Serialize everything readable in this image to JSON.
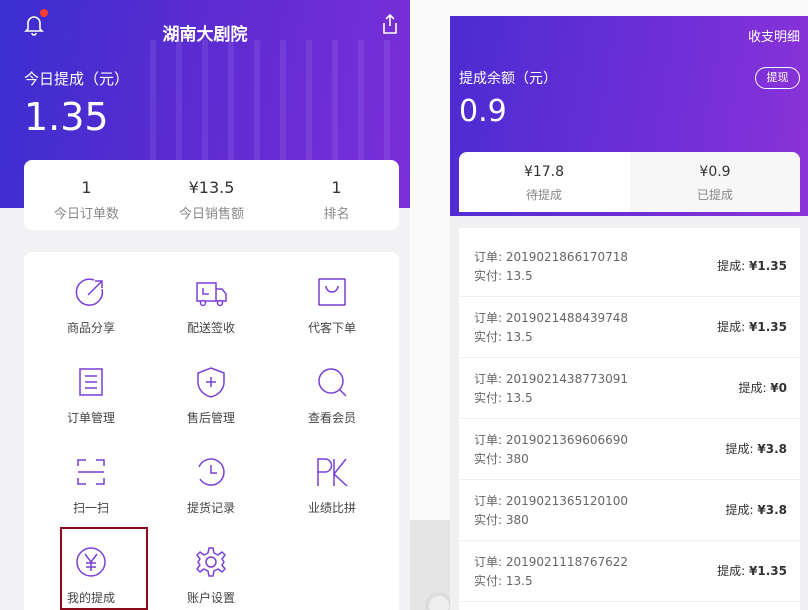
{
  "left": {
    "title": "湖南大剧院",
    "today_caption": "今日提成（元）",
    "today_amount": "1.35",
    "stats": [
      {
        "value": "1",
        "label": "今日订单数"
      },
      {
        "value": "¥13.5",
        "label": "今日销售额"
      },
      {
        "value": "1",
        "label": "排名"
      }
    ],
    "menu": [
      {
        "label": "商品分享",
        "icon": "share-arrow-icon"
      },
      {
        "label": "配送签收",
        "icon": "truck-icon"
      },
      {
        "label": "代客下单",
        "icon": "shopping-bag-icon"
      },
      {
        "label": "订单管理",
        "icon": "order-list-icon"
      },
      {
        "label": "售后管理",
        "icon": "shield-plus-icon"
      },
      {
        "label": "查看会员",
        "icon": "search-icon"
      },
      {
        "label": "扫一扫",
        "icon": "scan-icon"
      },
      {
        "label": "提货记录",
        "icon": "history-clock-icon"
      },
      {
        "label": "业绩比拼",
        "icon": "pk-icon"
      },
      {
        "label": "我的提成",
        "icon": "yuan-icon"
      },
      {
        "label": "账户设置",
        "icon": "gear-icon"
      }
    ],
    "accent_color": "#7a3fd6"
  },
  "right": {
    "detail_link": "收支明细",
    "balance_caption": "提成余额（元）",
    "withdraw_button": "提现",
    "balance_amount": "0.9",
    "tabs": [
      {
        "value": "¥17.8",
        "label": "待提成"
      },
      {
        "value": "¥0.9",
        "label": "已提成"
      }
    ],
    "records": [
      {
        "order": "订单: 2019021866170718",
        "paid": "实付: 13.5",
        "commission_label": "提成: ",
        "commission_value": "¥1.35"
      },
      {
        "order": "订单: 2019021488439748",
        "paid": "实付: 13.5",
        "commission_label": "提成: ",
        "commission_value": "¥1.35"
      },
      {
        "order": "订单: 2019021438773091",
        "paid": "实付: 13.5",
        "commission_label": "提成: ",
        "commission_value": "¥0"
      },
      {
        "order": "订单: 2019021369606690",
        "paid": "实付: 380",
        "commission_label": "提成: ",
        "commission_value": "¥3.8"
      },
      {
        "order": "订单: 2019021365120100",
        "paid": "实付: 380",
        "commission_label": "提成: ",
        "commission_value": "¥3.8"
      },
      {
        "order": "订单: 2019021118767622",
        "paid": "实付: 13.5",
        "commission_label": "提成: ",
        "commission_value": "¥1.35"
      }
    ]
  }
}
